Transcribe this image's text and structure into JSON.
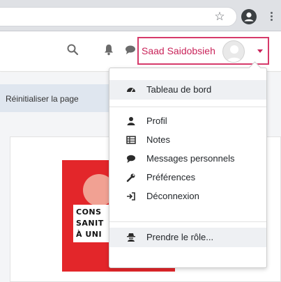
{
  "browser": {
    "icons": [
      "star-icon",
      "account-icon",
      "kebab-icon"
    ]
  },
  "navbar": {
    "icons": [
      "search-icon",
      "bell-icon",
      "chat-icon"
    ],
    "user_name": "Saad Saidobsieh",
    "accent_color": "#c9245a"
  },
  "page": {
    "reset_label": "Réinitialiser la page",
    "poster_lines": [
      "CONS",
      "SANIT",
      "À UNI"
    ]
  },
  "user_menu": {
    "items": [
      {
        "label": "Tableau de bord",
        "icon": "dashboard-icon"
      },
      {
        "label": "Profil",
        "icon": "user-icon"
      },
      {
        "label": "Notes",
        "icon": "table-icon"
      },
      {
        "label": "Messages personnels",
        "icon": "chat-icon"
      },
      {
        "label": "Préférences",
        "icon": "wrench-icon"
      },
      {
        "label": "Déconnexion",
        "icon": "logout-icon"
      },
      {
        "label": "Prendre le rôle...",
        "icon": "user-secret-icon"
      }
    ]
  }
}
